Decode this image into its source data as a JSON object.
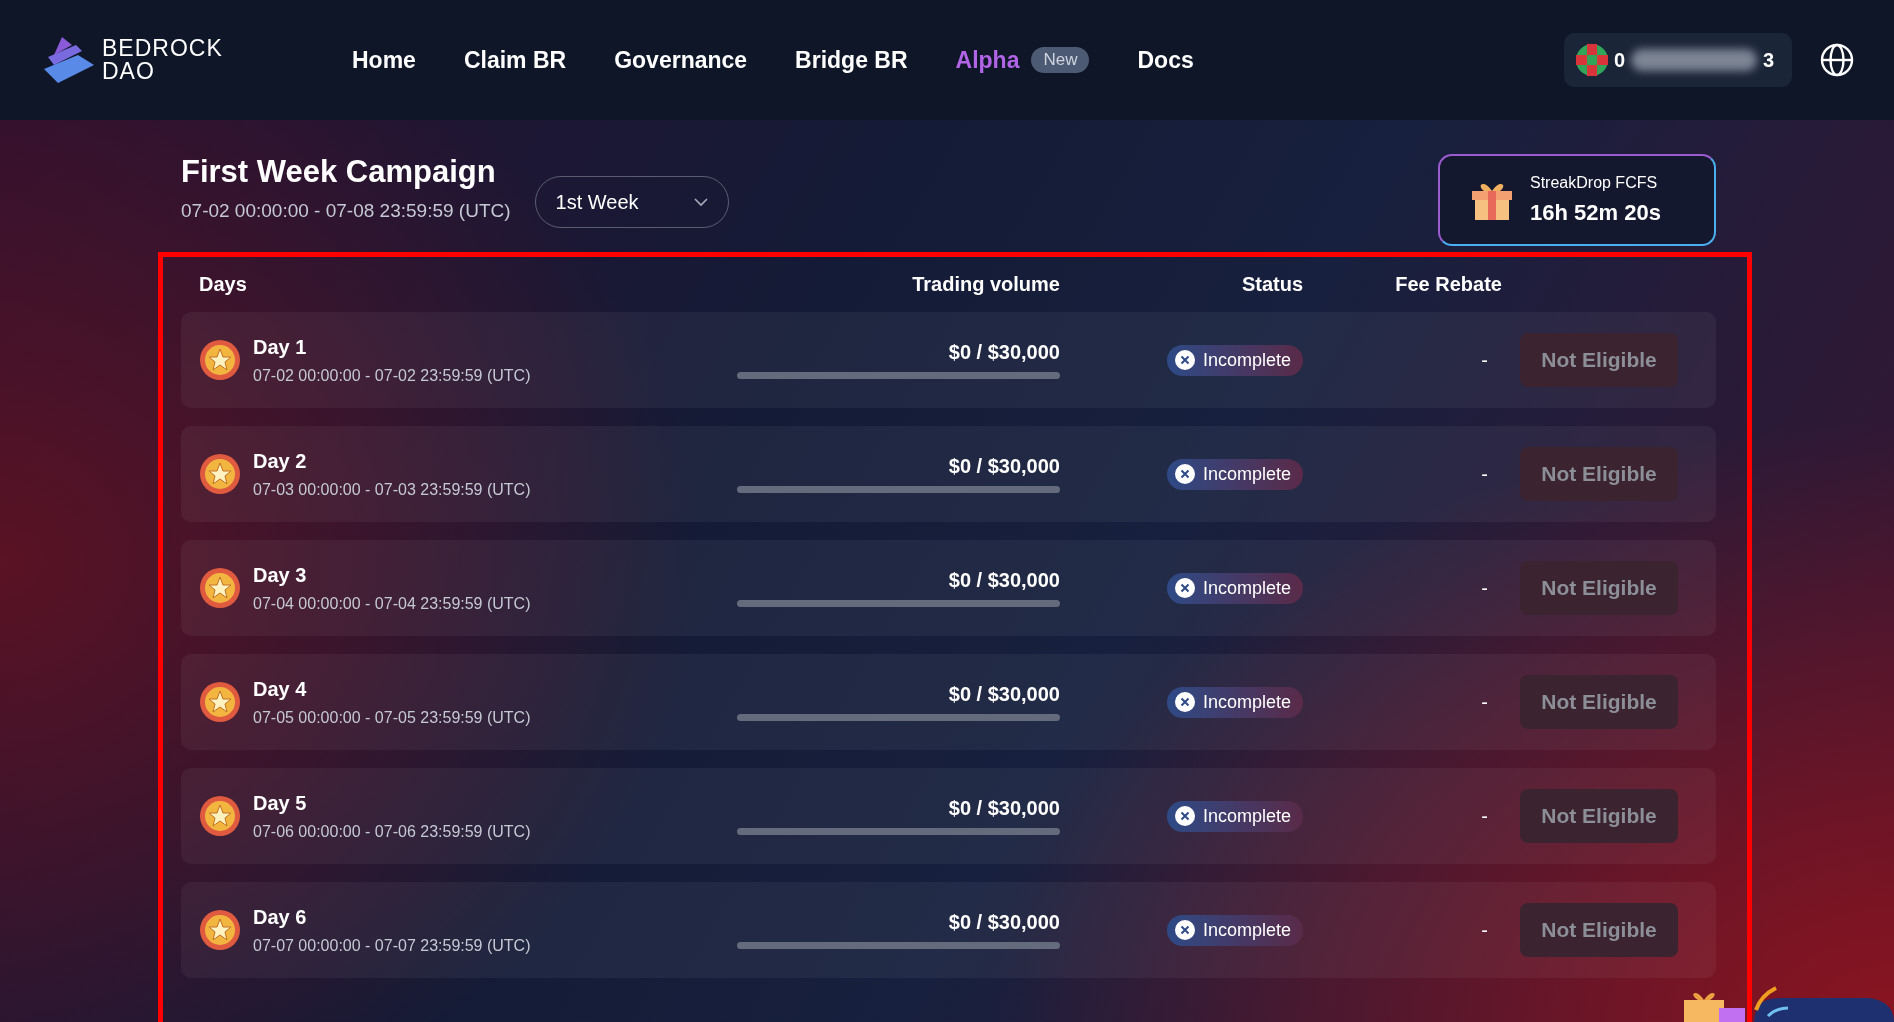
{
  "header": {
    "logo_lines": [
      "BEDROCK",
      "DAO"
    ],
    "nav": [
      {
        "label": "Home",
        "kind": "link"
      },
      {
        "label": "Claim BR",
        "kind": "link"
      },
      {
        "label": "Governance",
        "kind": "link"
      },
      {
        "label": "Bridge BR",
        "kind": "link"
      },
      {
        "label": "Alpha",
        "kind": "featured",
        "badge": "New"
      },
      {
        "label": "Docs",
        "kind": "link"
      }
    ],
    "wallet": {
      "address_start": "0",
      "address_end": "3"
    }
  },
  "campaign": {
    "title": "First Week Campaign",
    "range": "07-02 00:00:00 - 07-08 23:59:59 (UTC)",
    "week_select": {
      "value": "1st Week"
    }
  },
  "streak": {
    "title": "StreakDrop FCFS",
    "countdown": "16h 52m 20s"
  },
  "table": {
    "columns": [
      "Days",
      "Trading volume",
      "Status",
      "Fee Rebate"
    ],
    "rows": [
      {
        "day": "Day 1",
        "range": "07-02 00:00:00 - 07-02 23:59:59 (UTC)",
        "volume": "$0 / $30,000",
        "status": "Incomplete",
        "kind": "incomplete",
        "fee_rebate": "-",
        "action": "Not Eligible",
        "disabled": true
      },
      {
        "day": "Day 2",
        "range": "07-03 00:00:00 - 07-03 23:59:59 (UTC)",
        "volume": "$0 / $30,000",
        "status": "Incomplete",
        "kind": "incomplete",
        "fee_rebate": "-",
        "action": "Not Eligible",
        "disabled": true
      },
      {
        "day": "Day 3",
        "range": "07-04 00:00:00 - 07-04 23:59:59 (UTC)",
        "volume": "$0 / $30,000",
        "status": "Incomplete",
        "kind": "incomplete",
        "fee_rebate": "-",
        "action": "Not Eligible",
        "disabled": true
      },
      {
        "day": "Day 4",
        "range": "07-05 00:00:00 - 07-05 23:59:59 (UTC)",
        "volume": "$0 / $30,000",
        "status": "Incomplete",
        "kind": "incomplete",
        "fee_rebate": "-",
        "action": "Not Eligible",
        "disabled": true
      },
      {
        "day": "Day 5",
        "range": "07-06 00:00:00 - 07-06 23:59:59 (UTC)",
        "volume": "$0 / $30,000",
        "status": "Incomplete",
        "kind": "incomplete",
        "fee_rebate": "-",
        "action": "Not Eligible",
        "disabled": true
      },
      {
        "day": "Day 6",
        "range": "07-07 00:00:00 - 07-07 23:59:59 (UTC)",
        "volume": "$0 / $30,000",
        "status": "Incomplete",
        "kind": "incomplete",
        "fee_rebate": "-",
        "action": "Not Eligible",
        "disabled": true
      }
    ]
  }
}
